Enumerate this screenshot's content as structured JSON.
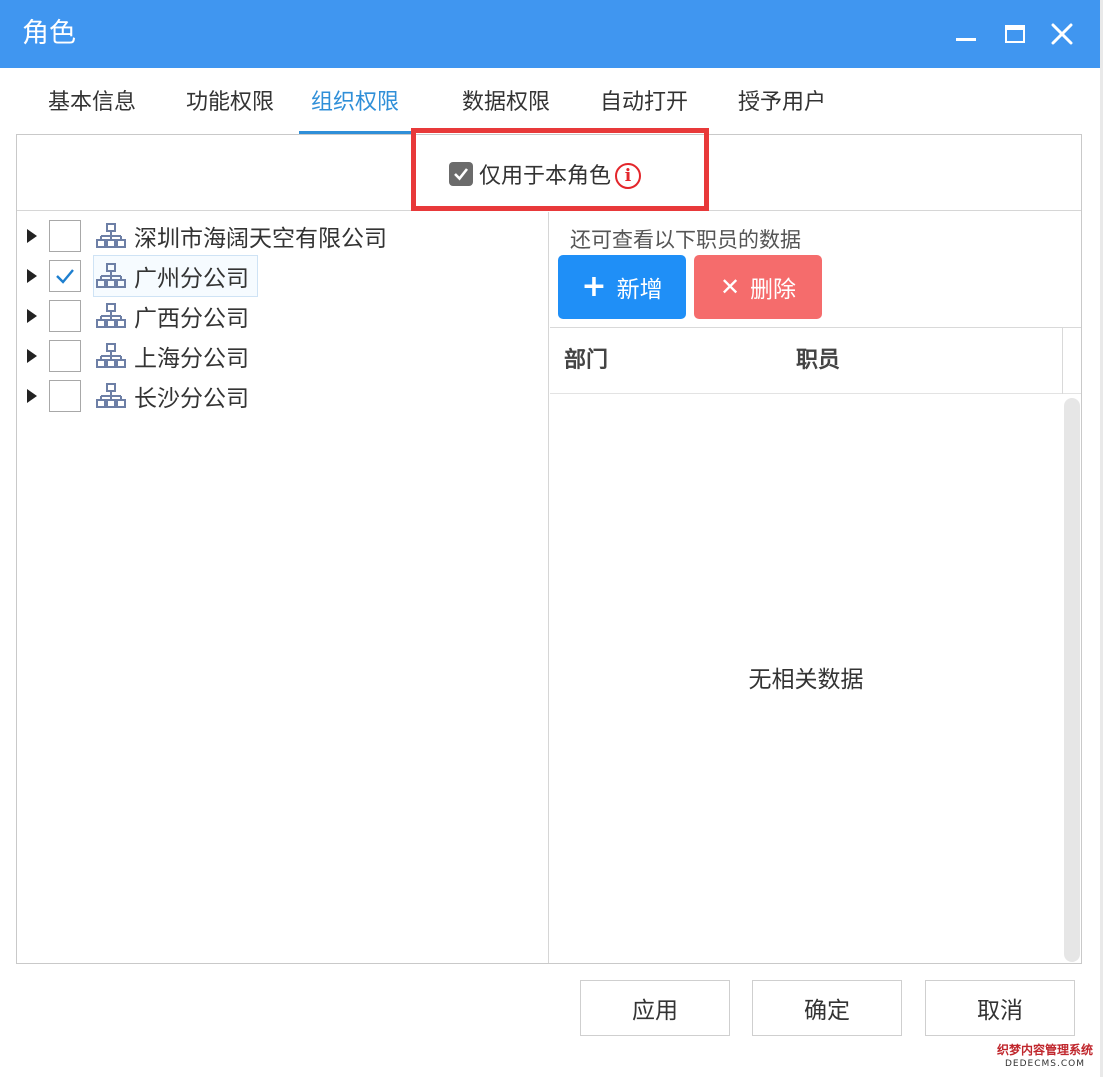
{
  "window": {
    "title": "角色",
    "titlebar_color": "#4096f0",
    "controls": [
      "minimize-icon",
      "maximize-icon",
      "close-icon"
    ]
  },
  "tabs": [
    {
      "label": "基本信息",
      "active": false
    },
    {
      "label": "功能权限",
      "active": false
    },
    {
      "label": "组织权限",
      "active": true
    },
    {
      "label": "数据权限",
      "active": false
    },
    {
      "label": "自动打开",
      "active": false
    },
    {
      "label": "授予用户",
      "active": false
    }
  ],
  "only_role": {
    "label": "仅用于本角色",
    "checked": true,
    "info_icon": "i",
    "highlight_color": "#e8393a"
  },
  "org_tree": [
    {
      "label": "深圳市海阔天空有限公司",
      "checked": false,
      "selected": false
    },
    {
      "label": "广州分公司",
      "checked": true,
      "selected": true
    },
    {
      "label": "广西分公司",
      "checked": false,
      "selected": false
    },
    {
      "label": "上海分公司",
      "checked": false,
      "selected": false
    },
    {
      "label": "长沙分公司",
      "checked": false,
      "selected": false
    }
  ],
  "employee_panel": {
    "hint": "还可查看以下职员的数据",
    "add_button": {
      "icon": "plus-icon",
      "glyph": "+",
      "label": "新增",
      "color": "#1f8ff7"
    },
    "delete_button": {
      "icon": "x-icon",
      "glyph": "✕",
      "label": "删除",
      "color": "#f56c6c"
    },
    "columns": [
      "部门",
      "职员"
    ],
    "rows": [],
    "empty_text": "无相关数据"
  },
  "footer": {
    "apply_label": "应用",
    "ok_label": "确定",
    "cancel_label": "取消"
  },
  "watermark": {
    "line1": "织梦内容管理系统",
    "line2": "DEDECMS.COM"
  }
}
